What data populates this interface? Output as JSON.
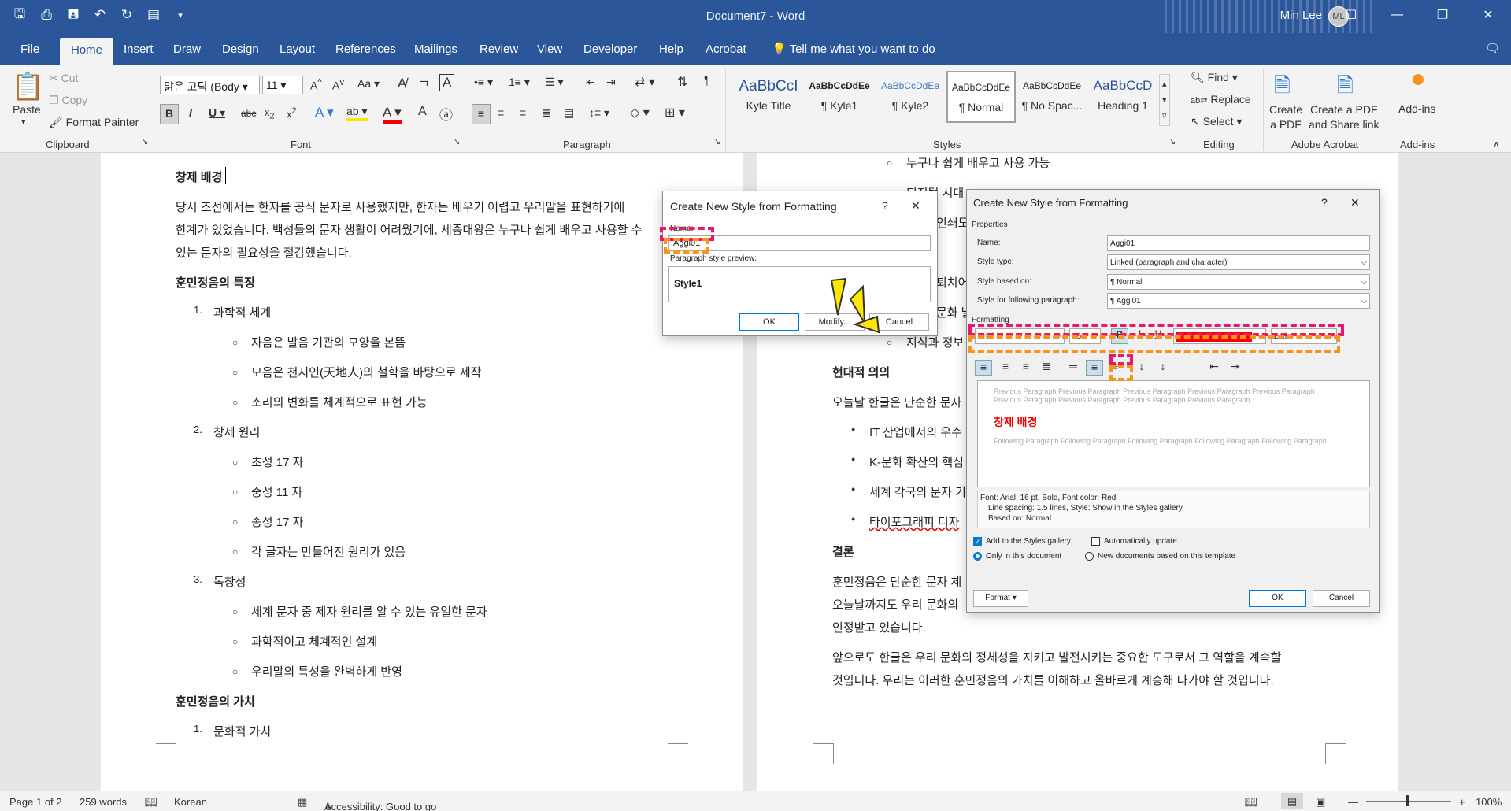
{
  "app": {
    "title": "Document7  -  Word",
    "user": "Min Lee",
    "avatar": "ML"
  },
  "qat": [
    "save-icon",
    "print-preview-icon",
    "save-as-icon",
    "undo-icon",
    "redo-icon",
    "layout-icon",
    "customize-icon"
  ],
  "menu": {
    "file": "File",
    "home": "Home",
    "insert": "Insert",
    "draw": "Draw",
    "design": "Design",
    "layout": "Layout",
    "references": "References",
    "mailings": "Mailings",
    "review": "Review",
    "view": "View",
    "developer": "Developer",
    "help": "Help",
    "acrobat": "Acrobat",
    "tellme": "Tell me what you want to do"
  },
  "ribbon": {
    "clipboard": {
      "label": "Clipboard",
      "paste": "Paste",
      "cut": "Cut",
      "copy": "Copy",
      "format_painter": "Format Painter"
    },
    "font": {
      "label": "Font",
      "name": "맑은 고딕 (Body",
      "size": "11"
    },
    "paragraph": {
      "label": "Paragraph"
    },
    "styles": {
      "label": "Styles",
      "items": [
        {
          "preview": "AaBbCcI",
          "name": "Kyle Title"
        },
        {
          "preview": "AaBbCcDdEe",
          "name": "¶ Kyle1"
        },
        {
          "preview": "AaBbCcDdEe",
          "name": "¶ Kyle2"
        },
        {
          "preview": "AaBbCcDdEe",
          "name": "¶ Normal"
        },
        {
          "preview": "AaBbCcDdEe",
          "name": "¶ No Spac..."
        },
        {
          "preview": "AaBbCcD",
          "name": "Heading 1"
        }
      ]
    },
    "editing": {
      "label": "Editing",
      "find": "Find",
      "replace": "Replace",
      "select": "Select"
    },
    "acrobat": {
      "label": "Adobe Acrobat",
      "create_pdf": "Create\na PDF",
      "create_share": "Create a PDF\nand Share link"
    },
    "addins": {
      "label": "Add-ins",
      "button": "Add-ins"
    }
  },
  "doc_left": {
    "h1": "창제 배경",
    "p1": [
      "당시 조선에서는 한자를 공식 문자로 사용했지만, 한자는 배우기 어렵고 우리말을 표현하기에",
      "한계가 있었습니다. 백성들의 문자 생활이 어려웠기에, 세종대왕은 누구나 쉽게 배우고 사용할 수",
      "있는 문자의 필요성을 절감했습니다."
    ],
    "h2": "훈민정음의 특징",
    "items": [
      {
        "num": "1.",
        "text": "과학적 체계",
        "subs": [
          "자음은 발음 기관의 모양을 본뜸",
          "모음은 천지인(天地人)의 철학을 바탕으로 제작",
          "소리의 변화를 체계적으로 표현 가능"
        ]
      },
      {
        "num": "2.",
        "text": "창제 원리",
        "subs": [
          "초성 17 자",
          "중성 11 자",
          "종성 17 자",
          "각 글자는 만들어진 원리가 있음"
        ]
      },
      {
        "num": "3.",
        "text": "독창성",
        "subs": [
          "세계 문자 중 제자 원리를 알 수 있는 유일한 문자",
          "과학적이고 체계적인 설계",
          "우리말의 특성을 완벽하게 반영"
        ]
      }
    ],
    "h3": "훈민정음의 가치",
    "item4": {
      "num": "1.",
      "text": "문화적 가치"
    }
  },
  "doc_right": {
    "top_subs": [
      "누구나 쉽게 배우고 사용 가능",
      "디지털 시대",
      "인쇄도",
      "퇴치어",
      "문화 발",
      "지식과 정보"
    ],
    "h1": "현대적 의의",
    "p1": "오늘날 한글은 단순한 문자",
    "bullets": [
      "IT 산업에서의 우수",
      "K-문화 확산의 핵심",
      "세계 각국의 문자 기",
      "타이포그래피 디자"
    ],
    "h2": "결론",
    "p2": [
      "훈민정음은 단순한 문자 체",
      "오늘날까지도 우리 문화의",
      "인정받고 있습니다."
    ],
    "p3": [
      "앞으로도 한글은 우리 문화의 정체성을 지키고 발전시키는 중요한 도구로서 그 역할을 계속할",
      "것입니다. 우리는 이러한 훈민정음의 가치를 이해하고 올바르게 계승해 나가야 할 것입니다."
    ]
  },
  "dialog_small": {
    "title": "Create New Style from Formatting",
    "help": "?",
    "close": "✕",
    "name_label": "Name:",
    "name_value": "Aggi01",
    "preview_label": "Paragraph style preview:",
    "preview_text": "Style1",
    "ok": "OK",
    "modify": "Modify...",
    "cancel": "Cancel"
  },
  "dialog_large": {
    "title": "Create New Style from Formatting",
    "help": "?",
    "close": "✕",
    "properties": "Properties",
    "name_label": "Name:",
    "name_value": "Aggi01",
    "type_label": "Style type:",
    "type_value": "Linked (paragraph and character)",
    "based_label": "Style based on:",
    "based_value": "¶  Normal",
    "following_label": "Style for following paragraph:",
    "following_value": "¶  Aggi01",
    "formatting": "Formatting",
    "font": "Arial",
    "size": "16",
    "script": "Latin",
    "font_color": "#ff0000",
    "prev_para": "Previous Paragraph Previous Paragraph Previous Paragraph Previous Paragraph Previous Paragraph Previous Paragraph Previous Paragraph Previous Paragraph Previous Paragraph",
    "sample": "창제 배경",
    "follow_para": "Following Paragraph Following Paragraph Following Paragraph Following Paragraph Following Paragraph",
    "desc": [
      "Font: Arial, 16 pt, Bold, Font color: Red",
      "Line spacing:  1.5 lines, Style: Show in the Styles gallery",
      "Based on: Normal"
    ],
    "add_gallery": "Add to the Styles gallery",
    "auto_update": "Automatically update",
    "only_doc": "Only in this document",
    "new_docs": "New documents based on this template",
    "format": "Format ▾",
    "ok": "OK",
    "cancel": "Cancel"
  },
  "status": {
    "page": "Page 1 of 2",
    "words": "259 words",
    "lang": "Korean",
    "accessibility": "Accessibility: Good to go",
    "zoom": "100%"
  },
  "colors": {
    "brand": "#2b579a",
    "highlight_pink": "#e8196a",
    "highlight_orange": "#f7941d",
    "arrow_yellow": "#ffe600"
  }
}
